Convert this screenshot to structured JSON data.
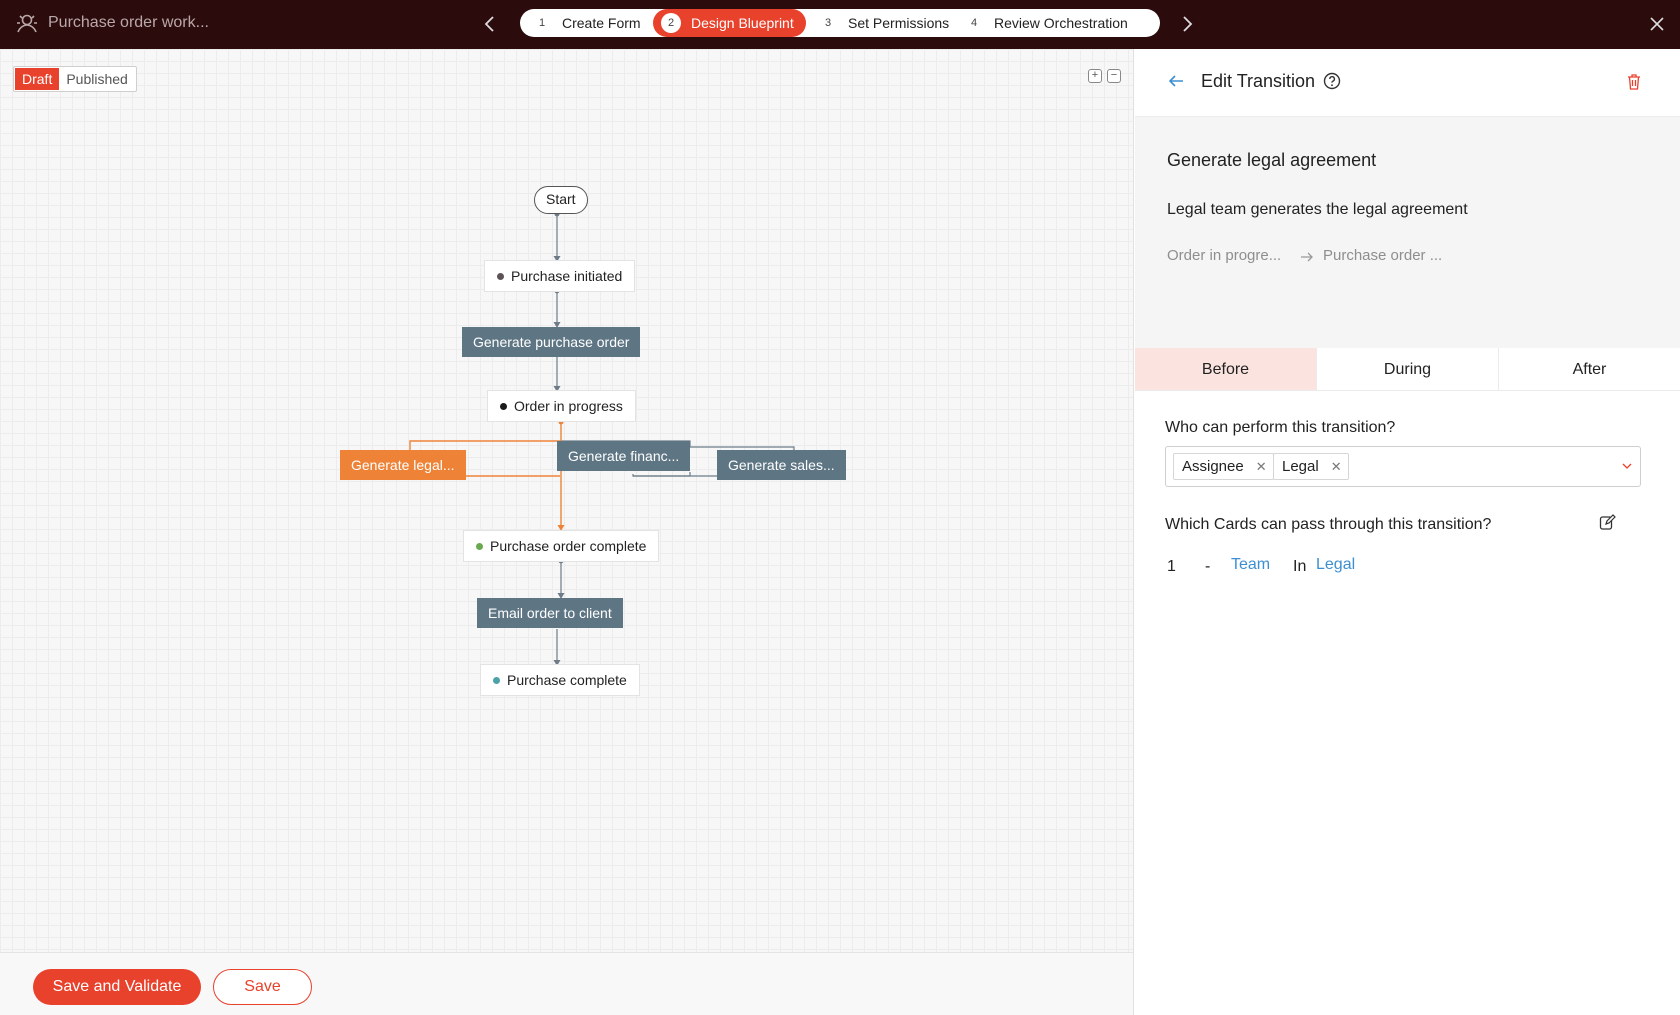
{
  "header": {
    "app_title": "Purchase order work...",
    "steps": [
      {
        "num": "1",
        "label": "Create Form"
      },
      {
        "num": "2",
        "label": "Design Blueprint"
      },
      {
        "num": "3",
        "label": "Set Permissions"
      },
      {
        "num": "4",
        "label": "Review Orchestration"
      }
    ],
    "active_step": 2,
    "icons": {
      "app": "app-logo-icon",
      "prev": "chevron-left-icon",
      "next": "chevron-right-icon",
      "close": "close-icon"
    }
  },
  "canvas": {
    "status_toggle": {
      "draft": "Draft",
      "published": "Published",
      "selected": "Draft"
    },
    "zoom": {
      "in": "+",
      "out": "−"
    },
    "flow": {
      "start": "Start",
      "states": [
        {
          "label": "Purchase initiated",
          "dot_color": "#5b5355"
        },
        {
          "label": "Order in progress",
          "dot_color": "#1a1a1a"
        },
        {
          "label": "Purchase order complete",
          "dot_color": "#6aa84f"
        },
        {
          "label": "Purchase complete",
          "dot_color": "#4aa3a8"
        }
      ],
      "transitions": [
        {
          "label": "Generate purchase order"
        },
        {
          "label": "Generate legal..."
        },
        {
          "label": "Generate financ..."
        },
        {
          "label": "Generate sales..."
        },
        {
          "label": "Email order to client"
        }
      ],
      "selected_transition": "Generate legal..."
    }
  },
  "footer": {
    "save_validate": "Save and Validate",
    "save": "Save"
  },
  "panel": {
    "title": "Edit Transition",
    "icons": {
      "back": "arrow-left-icon",
      "help": "help-circle-icon",
      "delete": "trash-icon",
      "edit": "edit-icon"
    },
    "transition_name": "Generate legal agreement",
    "description": "Legal team generates the legal agreement",
    "from_state": "Order in progre...",
    "to_state": "Purchase order ...",
    "tabs": [
      "Before",
      "During",
      "After"
    ],
    "active_tab": "Before",
    "perform_question": "Who can perform this transition?",
    "performers": [
      "Assignee",
      "Legal"
    ],
    "cards_question": "Which Cards can pass through this transition?",
    "card_rule": {
      "count": "1",
      "dash": "-",
      "field": "Team",
      "op": "In",
      "value": "Legal"
    }
  },
  "colors": {
    "accent": "#e8412c",
    "topbar": "#2c0b0d",
    "transition": "#5e7584",
    "transition_active": "#ee8338",
    "link": "#3d8fd1"
  }
}
